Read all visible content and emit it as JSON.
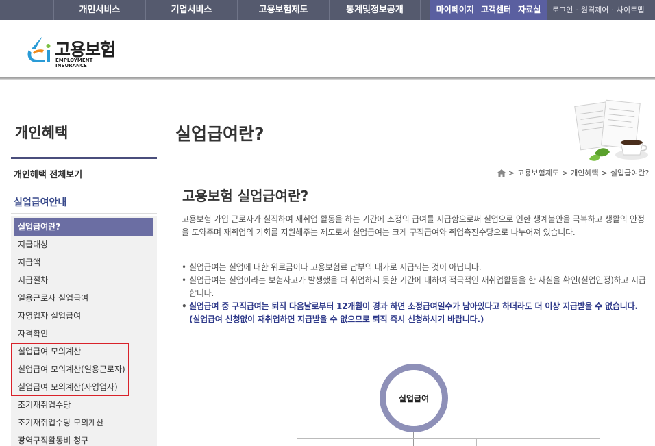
{
  "topnav": {
    "menu": [
      "개인서비스",
      "기업서비스",
      "고용보험제도",
      "통계및정보공개"
    ],
    "quick": [
      "마이페이지",
      "고객센터",
      "자료실"
    ],
    "util": [
      "로그인",
      "원격제어",
      "사이트맵"
    ],
    "util_sep": "·"
  },
  "logo": {
    "name": "고용보험",
    "sub": "EMPLOYMENT INSURANCE"
  },
  "sidebar": {
    "title": "개인혜택",
    "all_link": "개인혜택 전체보기",
    "section": "실업급여안내",
    "items": [
      "실업급여란?",
      "지급대상",
      "지급액",
      "지급절차",
      "일용근로자 실업급여",
      "자영업자 실업급여",
      "자격확인",
      "실업급여 모의계산",
      "실업급여 모의계산(일용근로자)",
      "실업급여 모의계산(자영업자)",
      "조기재취업수당",
      "조기재취업수당 모의계산",
      "광역구직활동비 청구"
    ]
  },
  "main": {
    "page_title": "실업급여란?",
    "breadcrumb": [
      "고용보험제도",
      "개인혜택",
      "실업급여란?"
    ],
    "breadcrumb_sep": ">",
    "heading": "고용보험 실업급여란?",
    "paragraph": "고용보험 가입 근로자가 실직하여 재취업 활동을 하는 기간에 소정의 급여를 지급함으로써 실업으로 인한 생계불안을 극복하고 생활의 안정을 도와주며 재취업의 기회를 지원해주는 제도로서 실업급여는 크게 구직급여와 취업촉진수당으로 나누어져 있습니다.",
    "bullets": [
      "실업급여는 실업에 대한 위로금이나 고용보험료 납부의 대가로 지급되는 것이 아닙니다.",
      "실업급여는 실업이라는 보험사고가 발생했을 때 취업하지 못한 기간에 대하여 적극적인 재취업활동을 한 사실을 확인(실업인정)하고 지급합니다."
    ],
    "strong_bullet": "실업급여 중 구직급여는 퇴직 다음날로부터 12개월이 경과 하면 소정급여일수가 남아있다고 하더라도 더 이상 지급받을 수 없습니다.",
    "strong_note": "(실업급여 신청없이 재취업하면 지급받을 수 없으므로 퇴직 즉시 신청하시기 바랍니다.)",
    "diagram_label": "실업급여"
  },
  "colors": {
    "topnav_bg": "#555a6e",
    "quick_bg": "#5a5fa0",
    "accent": "#6b6ea3",
    "highlight_border": "#d9222a",
    "emphasis_text": "#2f3a8a"
  }
}
